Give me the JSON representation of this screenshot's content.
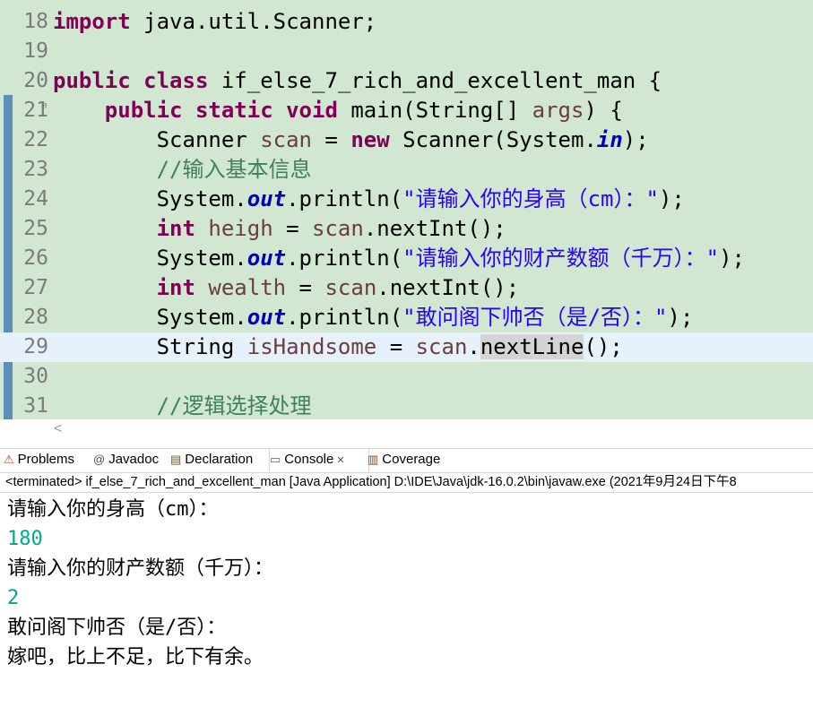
{
  "editor": {
    "lines": [
      {
        "num": "18",
        "tokens": [
          {
            "t": "import",
            "c": "kw"
          },
          {
            "t": " java.util.Scanner;",
            "c": ""
          }
        ]
      },
      {
        "num": "19",
        "tokens": []
      },
      {
        "num": "20",
        "tokens": [
          {
            "t": "public",
            "c": "kw"
          },
          {
            "t": " ",
            "c": ""
          },
          {
            "t": "class",
            "c": "kw"
          },
          {
            "t": " if_else_7_rich_and_excellent_man {",
            "c": ""
          }
        ]
      },
      {
        "num": "21",
        "fold": "⊖",
        "tokens": [
          {
            "t": "    ",
            "c": ""
          },
          {
            "t": "public",
            "c": "kw"
          },
          {
            "t": " ",
            "c": ""
          },
          {
            "t": "static",
            "c": "kw"
          },
          {
            "t": " ",
            "c": ""
          },
          {
            "t": "void",
            "c": "kw"
          },
          {
            "t": " main(String[] ",
            "c": ""
          },
          {
            "t": "args",
            "c": "var"
          },
          {
            "t": ") {",
            "c": ""
          }
        ]
      },
      {
        "num": "22",
        "tokens": [
          {
            "t": "        Scanner ",
            "c": ""
          },
          {
            "t": "scan",
            "c": "var"
          },
          {
            "t": " = ",
            "c": ""
          },
          {
            "t": "new",
            "c": "kw"
          },
          {
            "t": " Scanner(System.",
            "c": ""
          },
          {
            "t": "in",
            "c": "fld"
          },
          {
            "t": ");",
            "c": ""
          }
        ]
      },
      {
        "num": "23",
        "tokens": [
          {
            "t": "        ",
            "c": ""
          },
          {
            "t": "//输入基本信息",
            "c": "cmt"
          }
        ]
      },
      {
        "num": "24",
        "tokens": [
          {
            "t": "        System.",
            "c": ""
          },
          {
            "t": "out",
            "c": "fld"
          },
          {
            "t": ".println(",
            "c": ""
          },
          {
            "t": "\"请输入你的身高（cm）：\"",
            "c": "str"
          },
          {
            "t": ");",
            "c": ""
          }
        ]
      },
      {
        "num": "25",
        "tokens": [
          {
            "t": "        ",
            "c": ""
          },
          {
            "t": "int",
            "c": "kw"
          },
          {
            "t": " ",
            "c": ""
          },
          {
            "t": "heigh",
            "c": "var"
          },
          {
            "t": " = ",
            "c": ""
          },
          {
            "t": "scan",
            "c": "var"
          },
          {
            "t": ".nextInt();",
            "c": ""
          }
        ]
      },
      {
        "num": "26",
        "tokens": [
          {
            "t": "        System.",
            "c": ""
          },
          {
            "t": "out",
            "c": "fld"
          },
          {
            "t": ".println(",
            "c": ""
          },
          {
            "t": "\"请输入你的财产数额（千万）：\"",
            "c": "str"
          },
          {
            "t": ");",
            "c": ""
          }
        ]
      },
      {
        "num": "27",
        "tokens": [
          {
            "t": "        ",
            "c": ""
          },
          {
            "t": "int",
            "c": "kw"
          },
          {
            "t": " ",
            "c": ""
          },
          {
            "t": "wealth",
            "c": "var"
          },
          {
            "t": " = ",
            "c": ""
          },
          {
            "t": "scan",
            "c": "var"
          },
          {
            "t": ".nextInt();",
            "c": ""
          }
        ]
      },
      {
        "num": "28",
        "tokens": [
          {
            "t": "        System.",
            "c": ""
          },
          {
            "t": "out",
            "c": "fld"
          },
          {
            "t": ".println(",
            "c": ""
          },
          {
            "t": "\"敢问阁下帅否（是/否）：\"",
            "c": "str"
          },
          {
            "t": ");",
            "c": ""
          }
        ]
      },
      {
        "num": "29",
        "current": true,
        "tokens": [
          {
            "t": "        String ",
            "c": ""
          },
          {
            "t": "isHandsome",
            "c": "var"
          },
          {
            "t": " = ",
            "c": ""
          },
          {
            "t": "scan",
            "c": "var"
          },
          {
            "t": ".",
            "c": ""
          },
          {
            "t": "nextLine",
            "c": "occ"
          },
          {
            "t": "();",
            "c": ""
          }
        ]
      },
      {
        "num": "30",
        "tokens": []
      },
      {
        "num": "31",
        "tokens": [
          {
            "t": "        ",
            "c": ""
          },
          {
            "t": "//逻辑选择处理",
            "c": "cmt"
          }
        ]
      }
    ],
    "scroll_arrow": "<"
  },
  "views": {
    "tabs": [
      {
        "label": "Problems",
        "icon": "problems-icon",
        "glyph": "⚠",
        "color": "#c0392b"
      },
      {
        "label": "Javadoc",
        "icon": "javadoc-icon",
        "glyph": "@",
        "color": "#555555"
      },
      {
        "label": "Declaration",
        "icon": "declaration-icon",
        "glyph": "▤",
        "color": "#6b5a3a"
      },
      {
        "label": "Console",
        "icon": "console-icon",
        "glyph": "▭",
        "color": "#2e6fb0",
        "active": true,
        "close": "✕"
      },
      {
        "label": "Coverage",
        "icon": "coverage-icon",
        "glyph": "▥",
        "color": "#8b4513"
      }
    ]
  },
  "console": {
    "status": "<terminated> if_else_7_rich_and_excellent_man [Java Application] D:\\IDE\\Java\\jdk-16.0.2\\bin\\javaw.exe  (2021年9月24日下午8",
    "output": [
      {
        "text": "请输入你的身高（cm）：",
        "input": false
      },
      {
        "text": "180",
        "input": true
      },
      {
        "text": "请输入你的财产数额（千万）：",
        "input": false
      },
      {
        "text": "2",
        "input": true
      },
      {
        "text": "敢问阁下帅否（是/否）：",
        "input": false
      },
      {
        "text": "嫁吧，比上不足，比下有余。",
        "input": false
      }
    ],
    "input_color": "#00a88a"
  }
}
